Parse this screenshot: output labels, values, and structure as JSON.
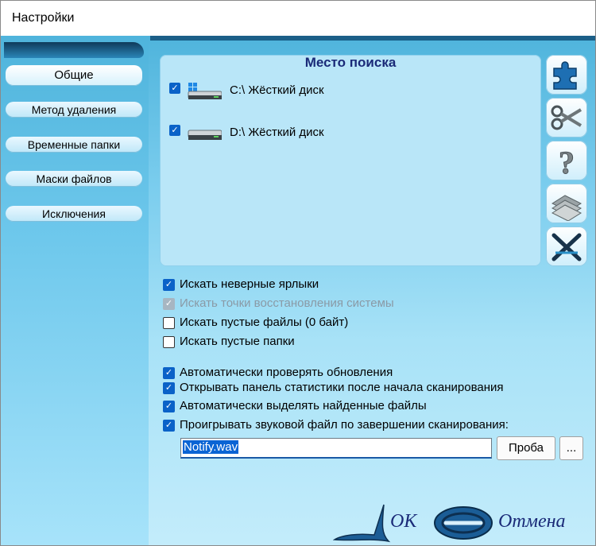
{
  "window": {
    "title": "Настройки"
  },
  "nav": {
    "items": [
      {
        "label": "Общие",
        "active": true
      },
      {
        "label": "Метод удаления"
      },
      {
        "label": "Временные папки"
      },
      {
        "label": "Маски файлов"
      },
      {
        "label": "Исключения"
      }
    ]
  },
  "search": {
    "title": "Место поиска",
    "drives": [
      {
        "label": "C:\\ Жёсткий диск",
        "checked": true,
        "icon": "drive-windows-icon"
      },
      {
        "label": "D:\\ Жёсткий диск",
        "checked": true,
        "icon": "drive-icon"
      }
    ]
  },
  "toolbar": {
    "icons": [
      "puzzle-icon",
      "scissors-icon",
      "question-icon",
      "folders-icon",
      "delete-x-icon"
    ]
  },
  "options": {
    "search_broken_shortcuts": "Искать неверные ярлыки",
    "search_restore_points": "Искать точки восстановления системы",
    "search_empty_files": "Искать пустые файлы (0 байт)",
    "search_empty_folders": "Искать пустые папки",
    "auto_check_updates": "Автоматически проверять обновления",
    "open_stats_panel": "Открывать панель статистики после начала сканирования",
    "auto_select_found": "Автоматически выделять найденные файлы",
    "play_sound": "Проигрывать звуковой файл по завершении сканирования:"
  },
  "sound": {
    "file_value": "Notify.wav",
    "test_button": "Проба",
    "browse_button": "..."
  },
  "footer": {
    "ok": "OK",
    "cancel": "Отмена"
  },
  "colors": {
    "accent": "#0a62c8",
    "panel": "#7bcdee",
    "title_text": "#1a2a78"
  }
}
